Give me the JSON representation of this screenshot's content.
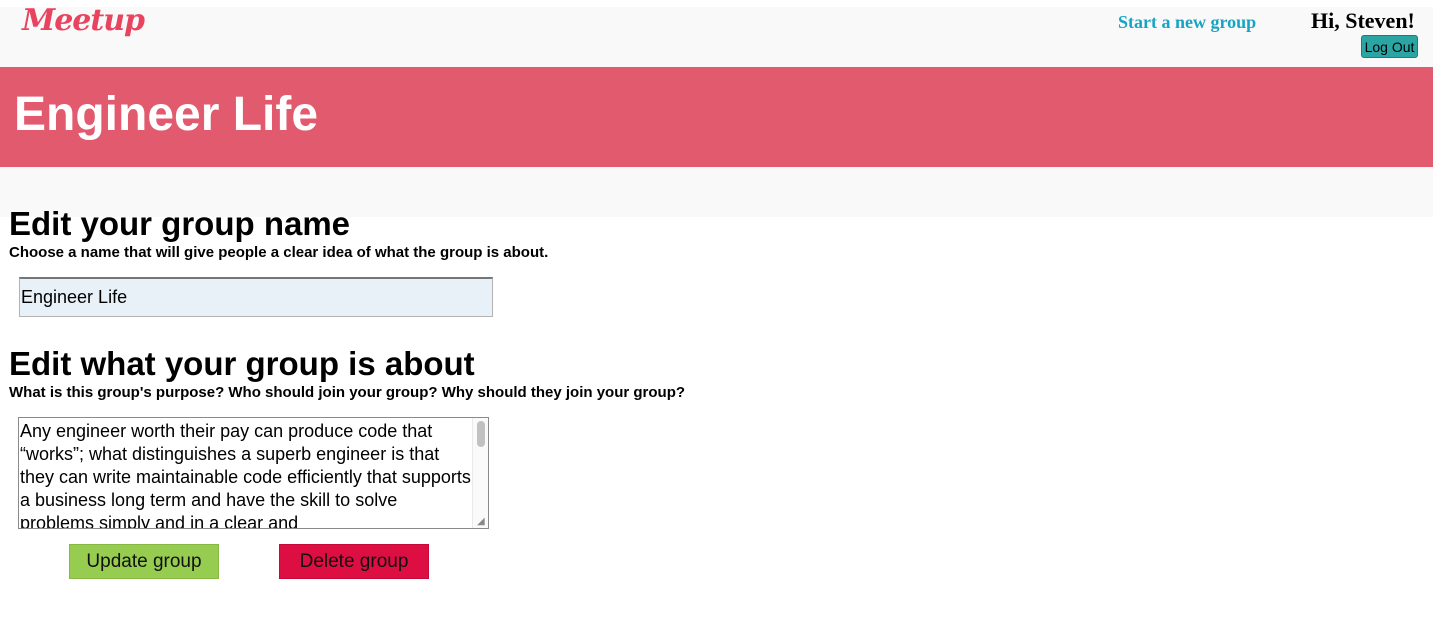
{
  "header": {
    "logo_text": "Meetup",
    "start_group_link": "Start a new group",
    "greeting": "Hi, Steven!",
    "logout_label": "Log Out"
  },
  "banner": {
    "title": "Engineer Life"
  },
  "name_section": {
    "heading": "Edit your group name",
    "description": "Choose a name that will give people a clear idea of what the group is about.",
    "input_value": "Engineer Life"
  },
  "about_section": {
    "heading": "Edit what your group is about",
    "description": "What is this group's purpose? Who should join your group? Why should they join your group?",
    "textarea_value": "Any engineer worth their pay can produce code that “works”; what distinguishes a superb engineer is that they can write maintainable code efficiently that supports a business long term and have the skill to solve problems simply and in a clear and"
  },
  "actions": {
    "update_label": "Update group",
    "delete_label": "Delete group"
  },
  "colors": {
    "brand": "#e8445f",
    "banner": "#e15a6d",
    "link": "#17a4c4",
    "update": "#96cc4f",
    "delete": "#dd0e42",
    "logout": "#2aa5a4"
  }
}
